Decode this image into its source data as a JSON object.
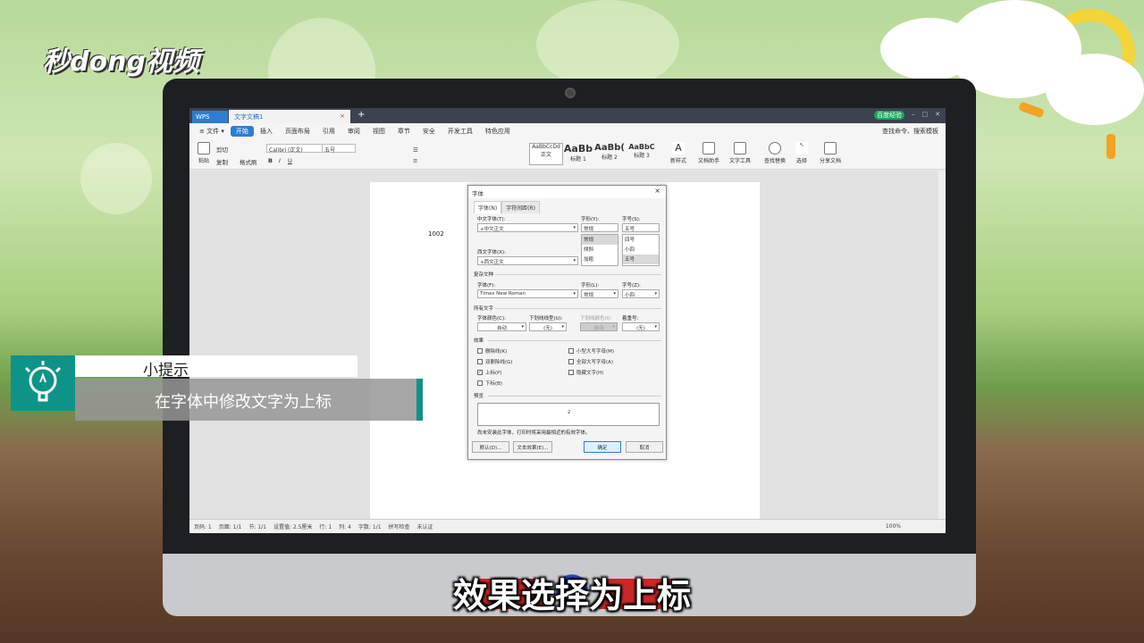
{
  "logo": {
    "text": "秒dong视频"
  },
  "titlebar": {
    "wps_tab": "WPS",
    "doc_tab": "文字文稿1",
    "doc_close": "×",
    "new_tab": "+",
    "login": "百度经验"
  },
  "menubar": {
    "items": [
      "≡ 文件 ▾",
      "开始",
      "插入",
      "页面布局",
      "引用",
      "审阅",
      "视图",
      "章节",
      "安全",
      "开发工具",
      "特色应用"
    ],
    "active": "开始",
    "search": "查找命令、搜索模板"
  },
  "ribbon": {
    "paste": "粘贴",
    "cut": "剪切",
    "copy": "复制",
    "format_painter": "格式刷",
    "font_name": "Calibri (正文)",
    "font_size": "五号",
    "styles": [
      {
        "preview": "AaBbCcDd",
        "label": "正文"
      },
      {
        "preview": "AaBb",
        "label": "标题 1"
      },
      {
        "preview": "AaBb(",
        "label": "标题 2"
      },
      {
        "preview": "AaBbC",
        "label": "标题 3"
      }
    ],
    "new_style": "新样式",
    "doc_helper": "文档助手",
    "text_tools": "文字工具",
    "find_replace": "查找替换",
    "select": "选择",
    "share": "分享文档"
  },
  "document": {
    "text": "1002"
  },
  "statusbar": {
    "page_no": "页码: 1",
    "pages": "页面: 1/1",
    "section": "节: 1/1",
    "setting": "设置值: 2.5厘米",
    "row": "行: 1",
    "col": "列: 4",
    "words": "字数: 1/1",
    "spell": "拼写检查",
    "cert": "未认证",
    "zoom": "100%"
  },
  "dialog": {
    "title": "字体",
    "close": "×",
    "tabs": [
      "字体(N)",
      "字符间距(R)"
    ],
    "cn_font_label": "中文字体(T):",
    "cn_font_value": "+中文正文",
    "style_label": "字形(Y):",
    "style_value": "常规",
    "style_list": [
      "常规",
      "倾斜",
      "加粗"
    ],
    "size_label": "字号(S):",
    "size_value": "五号",
    "size_list": [
      "四号",
      "小四",
      "五号"
    ],
    "west_font_label": "西文字体(X):",
    "west_font_value": "+西文正文",
    "complex_section": "复杂文种",
    "complex_font_label": "字体(F):",
    "complex_font_value": "Times New Roman",
    "complex_style_label": "字形(L):",
    "complex_style_value": "常规",
    "complex_size_label": "字号(Z):",
    "complex_size_value": "小四",
    "all_text_section": "所有文字",
    "color_label": "字体颜色(C):",
    "color_value": "自动",
    "underline_label": "下划线线型(U):",
    "underline_value": "(无)",
    "underline_color_label": "下划线颜色(I):",
    "underline_color_value": "自动",
    "emphasis_label": "着重号:",
    "emphasis_value": "(无)",
    "effects_section": "效果",
    "effects_left": [
      {
        "label": "删除线(K)",
        "checked": false
      },
      {
        "label": "双删除线(G)",
        "checked": false
      },
      {
        "label": "上标(P)",
        "checked": true
      },
      {
        "label": "下标(B)",
        "checked": false
      }
    ],
    "effects_right": [
      {
        "label": "小型大写字母(M)",
        "checked": false
      },
      {
        "label": "全部大写字母(A)",
        "checked": false
      },
      {
        "label": "隐藏文字(H)",
        "checked": false
      }
    ],
    "preview_section": "预览",
    "preview_text": "2",
    "note": "尚未安装此字体，打印时将采用最相近的有效字体。",
    "btn_default": "默认(D)...",
    "btn_effects": "文本效果(E)...",
    "btn_ok": "确定",
    "btn_cancel": "取消"
  },
  "tip": {
    "title": "小提示",
    "body": "在字体中修改文字为上标"
  },
  "subtitle": "效果选择为上标",
  "colors": {
    "accent": "#0e9388",
    "wps_blue": "#2d7dd2"
  }
}
